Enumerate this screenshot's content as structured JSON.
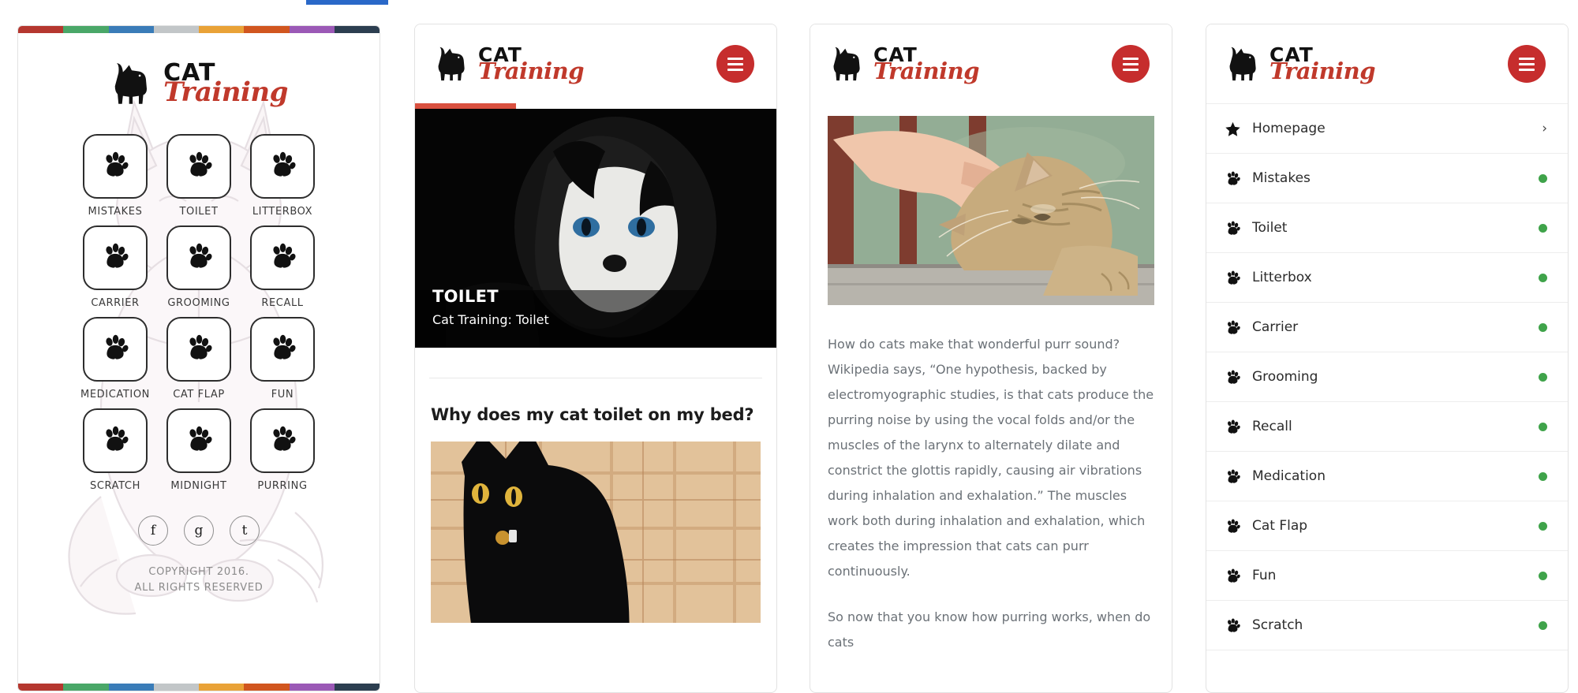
{
  "brand": {
    "word_top": "CAT",
    "word_bottom": "Training",
    "cat_icon": "cat-silhouette-icon",
    "accent_red": "#c0392b",
    "button_red": "#c62d2d",
    "dot_green": "#3fa34a"
  },
  "stripe": {
    "top_colors": [
      "#b5372f",
      "#4aa768",
      "#3a7cb8",
      "#c2c6c8",
      "#e9a237",
      "#d1561f",
      "#9b59b6",
      "#2c3e50"
    ],
    "bottom_colors": [
      "#b5372f",
      "#4aa768",
      "#3a7cb8",
      "#c2c6c8",
      "#e9a237",
      "#d1561f",
      "#9b59b6",
      "#2c3e50"
    ]
  },
  "panel1": {
    "name": "homepage-tile-grid",
    "tiles": [
      {
        "label": "MISTAKES",
        "icon": "paw-icon"
      },
      {
        "label": "TOILET",
        "icon": "paw-icon"
      },
      {
        "label": "LITTERBOX",
        "icon": "paw-icon"
      },
      {
        "label": "CARRIER",
        "icon": "paw-icon"
      },
      {
        "label": "GROOMING",
        "icon": "paw-icon"
      },
      {
        "label": "RECALL",
        "icon": "paw-icon"
      },
      {
        "label": "MEDICATION",
        "icon": "paw-icon"
      },
      {
        "label": "CAT FLAP",
        "icon": "paw-icon"
      },
      {
        "label": "FUN",
        "icon": "paw-icon"
      },
      {
        "label": "SCRATCH",
        "icon": "paw-icon"
      },
      {
        "label": "MIDNIGHT",
        "icon": "paw-icon"
      },
      {
        "label": "PURRING",
        "icon": "paw-icon"
      }
    ],
    "socials": [
      {
        "glyph": "f",
        "icon": "facebook-icon"
      },
      {
        "glyph": "g",
        "icon": "google-plus-icon"
      },
      {
        "glyph": "t",
        "icon": "twitter-icon"
      }
    ],
    "copyright_line1": "COPYRIGHT 2016.",
    "copyright_line2": "ALL RIGHTS RESERVED"
  },
  "panel2": {
    "progress_percent": 28,
    "menu_icon": "hamburger-icon",
    "hero": {
      "image": "black-and-white-cat-blue-eyes-photo",
      "title": "TOILET",
      "subtitle": "Cat Training: Toilet"
    },
    "article": {
      "heading": "Why does my cat toilet on my bed?",
      "image": "black-cat-yellow-eyes-on-plaid-blanket-photo"
    }
  },
  "panel3": {
    "menu_icon": "hamburger-icon",
    "image": "hand-petting-tabby-cat-photo",
    "paragraphs": [
      "How do cats make that wonderful purr sound? Wikipedia says, “One hypothesis, backed by electromyographic studies, is that cats produce the purring noise by using the vocal folds and/or the muscles of the larynx to alternately dilate and constrict the glottis rapidly, causing air vibrations during inhalation and exhalation.” The muscles work both during inhalation and exhalation, which creates the impression that cats can purr continuously.",
      "So now that you know how purring works, when do cats"
    ]
  },
  "panel4": {
    "menu_icon": "hamburger-icon",
    "items": [
      {
        "label": "Homepage",
        "icon": "star-icon",
        "trailing": "chevron-right-icon",
        "trailing_glyph": "›"
      },
      {
        "label": "Mistakes",
        "icon": "paw-icon",
        "trailing": "status-dot"
      },
      {
        "label": "Toilet",
        "icon": "paw-icon",
        "trailing": "status-dot"
      },
      {
        "label": "Litterbox",
        "icon": "paw-icon",
        "trailing": "status-dot"
      },
      {
        "label": "Carrier",
        "icon": "paw-icon",
        "trailing": "status-dot"
      },
      {
        "label": "Grooming",
        "icon": "paw-icon",
        "trailing": "status-dot"
      },
      {
        "label": "Recall",
        "icon": "paw-icon",
        "trailing": "status-dot"
      },
      {
        "label": "Medication",
        "icon": "paw-icon",
        "trailing": "status-dot"
      },
      {
        "label": "Cat Flap",
        "icon": "paw-icon",
        "trailing": "status-dot"
      },
      {
        "label": "Fun",
        "icon": "paw-icon",
        "trailing": "status-dot"
      },
      {
        "label": "Scratch",
        "icon": "paw-icon",
        "trailing": "status-dot"
      }
    ]
  }
}
